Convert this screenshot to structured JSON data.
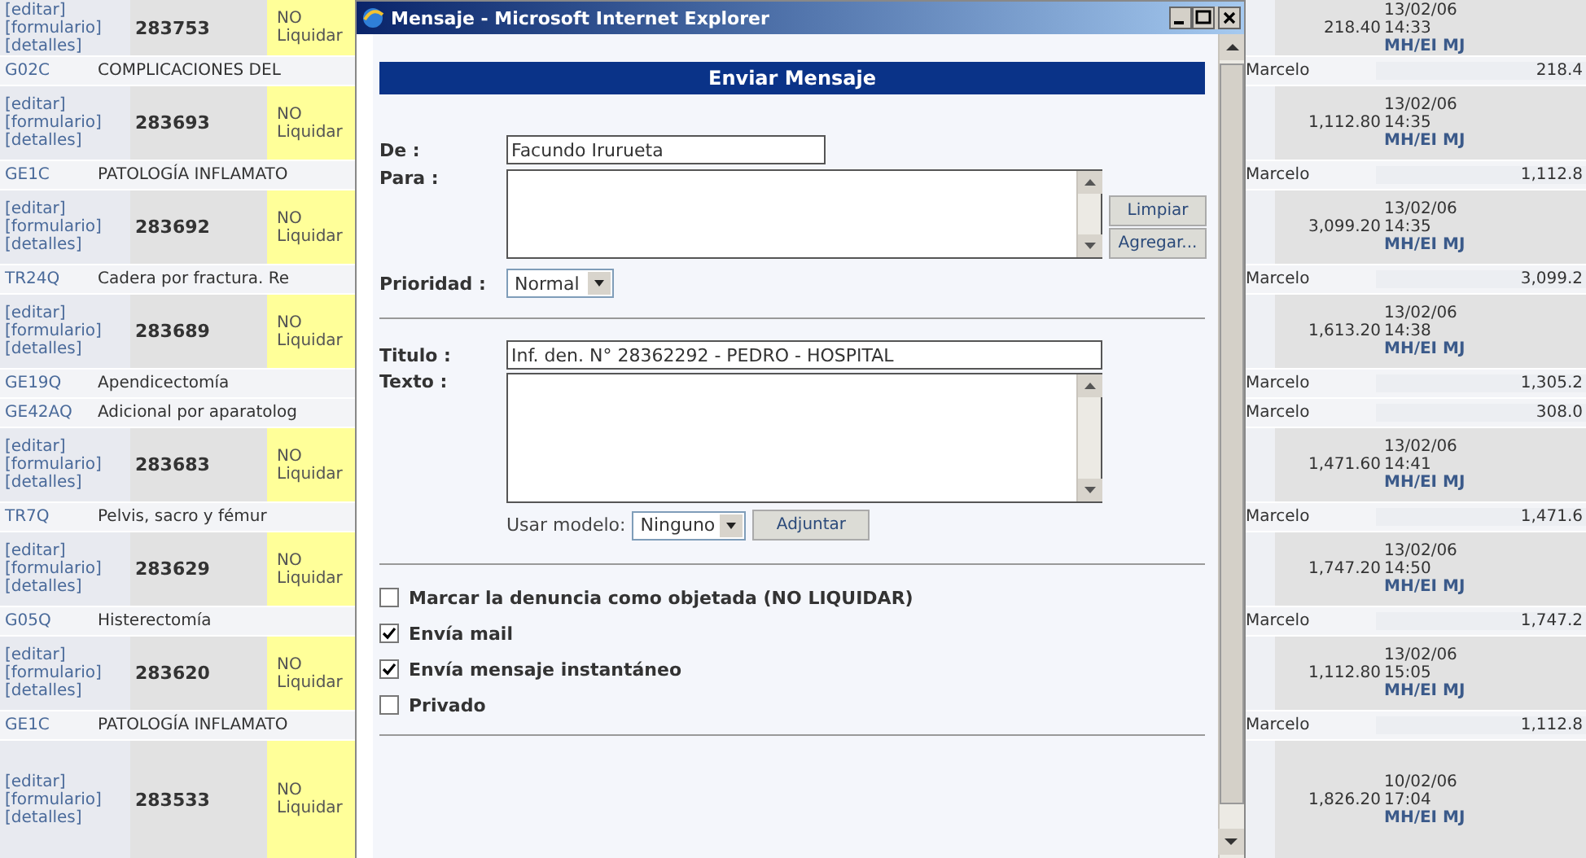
{
  "background_table": {
    "rows": [
      {
        "kind": "record",
        "links": [
          "[editar]",
          "[formulario]",
          "[detalles]"
        ],
        "number": "283753",
        "status": "NO Liquidar",
        "amount": "218.40",
        "date": "13/02/06",
        "time": "14:33",
        "codes": "MH/EI MJ"
      },
      {
        "kind": "code",
        "code": "G02C",
        "description": "COMPLICACIONES DEL",
        "doctor": "Marcelo",
        "amount": "218.4"
      },
      {
        "kind": "record",
        "links": [
          "[editar]",
          "[formulario]",
          "[detalles]"
        ],
        "number": "283693",
        "status": "NO Liquidar",
        "amount": "1,112.80",
        "date": "13/02/06",
        "time": "14:35",
        "codes": "MH/EI MJ"
      },
      {
        "kind": "code",
        "code": "GE1C",
        "description": "PATOLOGÍA INFLAMATO",
        "doctor": "Marcelo",
        "amount": "1,112.8"
      },
      {
        "kind": "record",
        "links": [
          "[editar]",
          "[formulario]",
          "[detalles]"
        ],
        "number": "283692",
        "status": "NO Liquidar",
        "amount": "3,099.20",
        "date": "13/02/06",
        "time": "14:35",
        "codes": "MH/EI MJ"
      },
      {
        "kind": "code",
        "code": "TR24Q",
        "description": "Cadera por fractura. Re",
        "doctor": "Marcelo",
        "amount": "3,099.2"
      },
      {
        "kind": "record",
        "links": [
          "[editar]",
          "[formulario]",
          "[detalles]"
        ],
        "number": "283689",
        "status": "NO Liquidar",
        "amount": "1,613.20",
        "date": "13/02/06",
        "time": "14:38",
        "codes": "MH/EI MJ"
      },
      {
        "kind": "code",
        "code": "GE19Q",
        "description": "Apendicectomía",
        "doctor": "Marcelo",
        "amount": "1,305.2"
      },
      {
        "kind": "code",
        "code": "GE42AQ",
        "description": "Adicional por aparatolog",
        "doctor": "Marcelo",
        "amount": "308.0"
      },
      {
        "kind": "record",
        "links": [
          "[editar]",
          "[formulario]",
          "[detalles]"
        ],
        "number": "283683",
        "status": "NO Liquidar",
        "amount": "1,471.60",
        "date": "13/02/06",
        "time": "14:41",
        "codes": "MH/EI MJ"
      },
      {
        "kind": "code",
        "code": "TR7Q",
        "description": "Pelvis, sacro y fémur",
        "doctor": "Marcelo",
        "amount": "1,471.6"
      },
      {
        "kind": "record",
        "links": [
          "[editar]",
          "[formulario]",
          "[detalles]"
        ],
        "number": "283629",
        "status": "NO Liquidar",
        "amount": "1,747.20",
        "date": "13/02/06",
        "time": "14:50",
        "codes": "MH/EI MJ"
      },
      {
        "kind": "code",
        "code": "G05Q",
        "description": "Histerectomía",
        "doctor": "Marcelo",
        "amount": "1,747.2"
      },
      {
        "kind": "record",
        "links": [
          "[editar]",
          "[formulario]",
          "[detalles]"
        ],
        "number": "283620",
        "status": "NO Liquidar",
        "amount": "1,112.80",
        "date": "13/02/06",
        "time": "15:05",
        "codes": "MH/EI MJ"
      },
      {
        "kind": "code",
        "code": "GE1C",
        "description": "PATOLOGÍA INFLAMATO",
        "doctor": "Marcelo",
        "amount": "1,112.8"
      },
      {
        "kind": "record",
        "links": [
          "[editar]",
          "[formulario]",
          "[detalles]"
        ],
        "number": "283533",
        "status": "NO Liquidar",
        "amount": "1,826.20",
        "date": "10/02/06",
        "time": "17:04",
        "codes": "MH/EI MJ"
      }
    ]
  },
  "dialog": {
    "title": "Mensaje - Microsoft Internet Explorer",
    "heading": "Enviar Mensaje",
    "from": {
      "label": "De :",
      "value": "Facundo Irurueta"
    },
    "to": {
      "label": "Para :"
    },
    "buttons": [
      "Limpiar",
      "Agregar..."
    ],
    "priority": {
      "label": "Prioridad :",
      "value": "Normal"
    },
    "subject": {
      "label": "Titulo :",
      "value": "Inf. den. N° 28362292 - PEDRO - HOSPITAL"
    },
    "body": {
      "label": "Texto :"
    },
    "template": {
      "label": "Usar modelo:",
      "value": "Ninguno"
    },
    "attach_button": "Adjuntar",
    "options": [
      {
        "label": "Marcar la denuncia como objetada (NO LIQUIDAR)",
        "checked": false
      },
      {
        "label": "Envía mail",
        "checked": true
      },
      {
        "label": "Envía mensaje instantáneo",
        "checked": true
      },
      {
        "label": "Privado",
        "checked": false
      }
    ]
  }
}
